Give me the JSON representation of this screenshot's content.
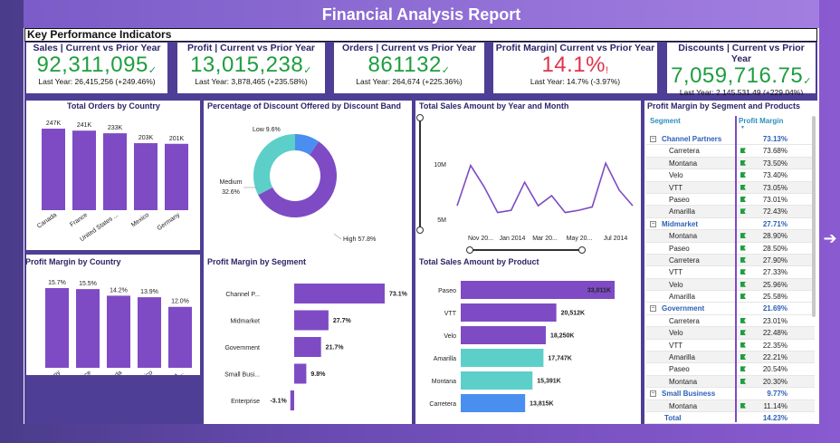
{
  "title": "Financial Analysis Report",
  "kpi_header": "Key Performance Indicators",
  "kpis": [
    {
      "title": "Sales | Current vs Prior Year",
      "value": "92,311,095",
      "mark": "✓",
      "sub": "Last Year: 26,415,256 (+249.46%)"
    },
    {
      "title": "Profit | Current vs Prior Year",
      "value": "13,015,238",
      "mark": "✓",
      "sub": "Last Year: 3,878,465 (+235.58%)"
    },
    {
      "title": "Orders | Current vs Prior Year",
      "value": "861132",
      "mark": "✓",
      "sub": "Last Year: 264,674 (+225.36%)"
    },
    {
      "title": "Profit Margin| Current vs Prior Year",
      "value": "14.1%",
      "mark": "!",
      "sub": "Last Year: 14.7% (-3.97%)"
    },
    {
      "title": "Discounts | Current vs Prior Year",
      "value": "7,059,716.75",
      "mark": "✓",
      "sub": "Last Year: 2,145,531.49 (+229.04%)"
    }
  ],
  "colors": {
    "bar": "#7e4bc4",
    "teal": "#5ccfc9",
    "blue": "#4a8ff0",
    "kpi_green": "#1e9e3f",
    "kpi_red": "#e0324a",
    "band": "#4e3e95"
  },
  "orders_by_country": {
    "title": "Total Orders by Country",
    "chart_data": {
      "type": "bar",
      "categories": [
        "Canada",
        "France",
        "United States ...",
        "Mexico",
        "Germany"
      ],
      "values": [
        247,
        241,
        233,
        203,
        201
      ],
      "labels": [
        "247K",
        "241K",
        "233K",
        "203K",
        "201K"
      ]
    }
  },
  "margin_by_country": {
    "title": "Profit Margin by Country",
    "chart_data": {
      "type": "bar",
      "categories": [
        "Germany",
        "France",
        "Canada",
        "Mexico",
        "United States of A..."
      ],
      "values": [
        15.7,
        15.5,
        14.2,
        13.9,
        12.0
      ],
      "labels": [
        "15.7%",
        "15.5%",
        "14.2%",
        "13.9%",
        "12.0%"
      ]
    }
  },
  "discount_donut": {
    "title": "Percentage of Discount Offered by Discount Band",
    "chart_data": {
      "type": "pie",
      "categories": [
        "High",
        "Medium",
        "Low"
      ],
      "values": [
        57.8,
        32.6,
        9.6
      ],
      "labels": [
        "High 57.8%",
        "Medium",
        "32.6%",
        "Low 9.6%"
      ]
    }
  },
  "sales_by_month": {
    "title": "Total Sales Amount by Year and Month",
    "chart_data": {
      "type": "line",
      "x_labels": [
        "Nov 20...",
        "Jan 2014",
        "Mar 20...",
        "May 20...",
        "Jul 2014"
      ],
      "y_ticks": [
        "10M",
        "5M"
      ],
      "values": [
        6.2,
        9.8,
        7.9,
        5.6,
        5.8,
        8.3,
        6.2,
        7.1,
        5.6,
        5.8,
        6.1,
        10.0,
        7.6,
        6.2
      ]
    }
  },
  "margin_by_segment": {
    "title": "Profit Margin by Segment",
    "chart_data": {
      "type": "bar",
      "categories": [
        "Channel P...",
        "Midmarket",
        "Government",
        "Small Busi...",
        "Enterprise"
      ],
      "values": [
        73.1,
        27.7,
        21.7,
        9.8,
        -3.1
      ],
      "labels": [
        "73.1%",
        "27.7%",
        "21.7%",
        "9.8%",
        "-3.1%"
      ]
    }
  },
  "sales_by_product": {
    "title": "Total Sales Amount by Product",
    "chart_data": {
      "type": "bar",
      "categories": [
        "Paseo",
        "VTT",
        "Velo",
        "Amarilla",
        "Montana",
        "Carretera"
      ],
      "values": [
        33011,
        20512,
        18250,
        17747,
        15391,
        13815
      ],
      "labels": [
        "33,011K",
        "20,512K",
        "18,250K",
        "17,747K",
        "15,391K",
        "13,815K"
      ]
    }
  },
  "segment_table": {
    "title": "Profit Margin by Segment and Products",
    "col1": "Segment",
    "col2": "Profit Margin",
    "toggle": "−",
    "rows": [
      {
        "type": "grp",
        "name": "Channel Partners",
        "value": "73.13%"
      },
      {
        "type": "sub",
        "name": "Carretera",
        "value": "73.68%"
      },
      {
        "type": "sub",
        "name": "Montana",
        "value": "73.50%"
      },
      {
        "type": "sub",
        "name": "Velo",
        "value": "73.40%"
      },
      {
        "type": "sub",
        "name": "VTT",
        "value": "73.05%"
      },
      {
        "type": "sub",
        "name": "Paseo",
        "value": "73.01%"
      },
      {
        "type": "sub",
        "name": "Amarilla",
        "value": "72.43%"
      },
      {
        "type": "grp",
        "name": "Midmarket",
        "value": "27.71%"
      },
      {
        "type": "sub",
        "name": "Montana",
        "value": "28.90%"
      },
      {
        "type": "sub",
        "name": "Paseo",
        "value": "28.50%"
      },
      {
        "type": "sub",
        "name": "Carretera",
        "value": "27.90%"
      },
      {
        "type": "sub",
        "name": "VTT",
        "value": "27.33%"
      },
      {
        "type": "sub",
        "name": "Velo",
        "value": "25.96%"
      },
      {
        "type": "sub",
        "name": "Amarilla",
        "value": "25.58%"
      },
      {
        "type": "grp",
        "name": "Government",
        "value": "21.69%"
      },
      {
        "type": "sub",
        "name": "Carretera",
        "value": "23.01%"
      },
      {
        "type": "sub",
        "name": "Velo",
        "value": "22.48%"
      },
      {
        "type": "sub",
        "name": "VTT",
        "value": "22.35%"
      },
      {
        "type": "sub",
        "name": "Amarilla",
        "value": "22.21%"
      },
      {
        "type": "sub",
        "name": "Paseo",
        "value": "20.54%"
      },
      {
        "type": "sub",
        "name": "Montana",
        "value": "20.30%"
      },
      {
        "type": "grp",
        "name": "Small Business",
        "value": "9.77%"
      },
      {
        "type": "sub",
        "name": "Montana",
        "value": "11.14%"
      },
      {
        "type": "total",
        "name": "Total",
        "value": "14.23%"
      }
    ]
  },
  "nav_arrow": "➔"
}
